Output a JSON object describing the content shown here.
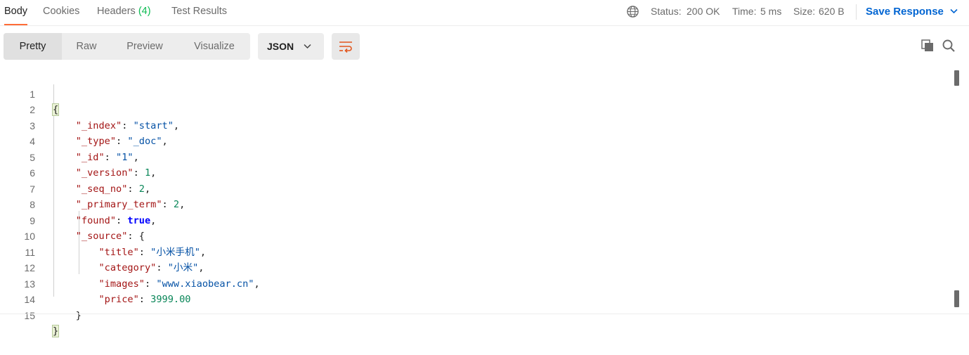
{
  "tabs": {
    "body": "Body",
    "cookies": "Cookies",
    "headers": "Headers",
    "headers_count": "(4)",
    "test_results": "Test Results"
  },
  "status": {
    "status_label": "Status:",
    "status_value": "200 OK",
    "time_label": "Time:",
    "time_value": "5 ms",
    "size_label": "Size:",
    "size_value": "620 B"
  },
  "save_response": "Save Response",
  "view_modes": [
    "Pretty",
    "Raw",
    "Preview",
    "Visualize"
  ],
  "format": "JSON",
  "icons": {
    "globe": "globe-icon",
    "wrap": "wrap-lines-icon",
    "copy": "copy-icon",
    "search": "search-icon"
  },
  "colors": {
    "accent_tab": "#ff6c37",
    "status_ok": "#007f31",
    "link_blue": "#0265d2",
    "json_key": "#a31515",
    "json_string": "#0451a5",
    "json_number": "#098658",
    "json_bool": "#0000ff"
  },
  "editor": {
    "line_numbers": [
      "1",
      "2",
      "3",
      "4",
      "5",
      "6",
      "7",
      "8",
      "9",
      "10",
      "11",
      "12",
      "13",
      "14",
      "15"
    ],
    "open_brace": "{",
    "close_brace": "}",
    "index": {
      "key": "\"_index\"",
      "value": "\"start\""
    },
    "type": {
      "key": "\"_type\"",
      "value": "\"_doc\""
    },
    "id": {
      "key": "\"_id\"",
      "value": "\"1\""
    },
    "version": {
      "key": "\"_version\"",
      "value": "1"
    },
    "seq_no": {
      "key": "\"_seq_no\"",
      "value": "2"
    },
    "primary_term": {
      "key": "\"_primary_term\"",
      "value": "2"
    },
    "found": {
      "key": "\"found\"",
      "value": "true"
    },
    "source": {
      "key": "\"_source\""
    },
    "title": {
      "key": "\"title\"",
      "value": "\"小米手机\""
    },
    "category": {
      "key": "\"category\"",
      "value": "\"小米\""
    },
    "images": {
      "key": "\"images\"",
      "value": "\"www.xiaobear.cn\""
    },
    "price": {
      "key": "\"price\"",
      "value": "3999.00"
    }
  }
}
